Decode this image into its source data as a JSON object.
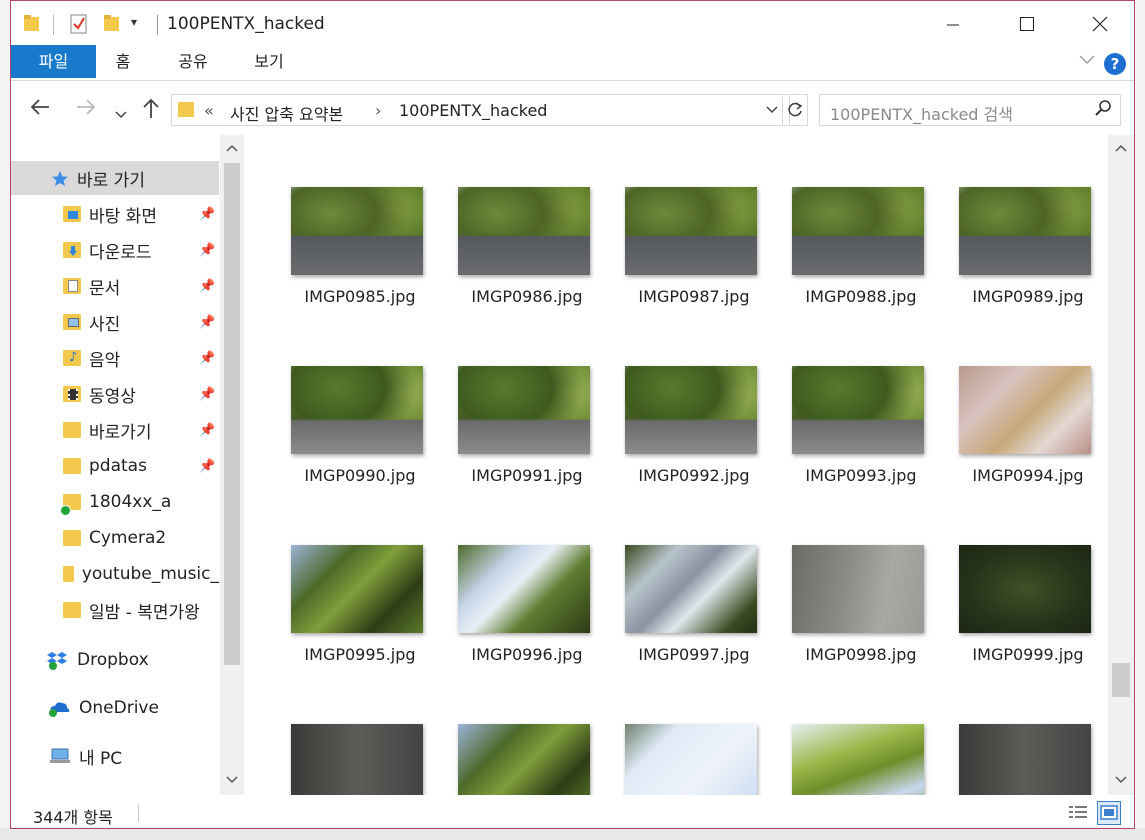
{
  "window": {
    "title": "100PENTX_hacked"
  },
  "ribbon": {
    "tabs": [
      {
        "label": "파일",
        "active": true
      },
      {
        "label": "홈",
        "active": false
      },
      {
        "label": "공유",
        "active": false
      },
      {
        "label": "보기",
        "active": false
      }
    ],
    "help_label": "?"
  },
  "address": {
    "prefix": "«",
    "crumbs": [
      "사진 압축 요약본",
      "100PENTX_hacked"
    ],
    "separator": "›"
  },
  "search": {
    "placeholder": "100PENTX_hacked 검색"
  },
  "nav": {
    "quick_access": "바로 가기",
    "pinned": [
      {
        "label": "바탕 화면",
        "icon": "desktop-folder-icon"
      },
      {
        "label": "다운로드",
        "icon": "downloads-folder-icon"
      },
      {
        "label": "문서",
        "icon": "documents-folder-icon"
      },
      {
        "label": "사진",
        "icon": "pictures-folder-icon"
      },
      {
        "label": "음악",
        "icon": "music-folder-icon"
      },
      {
        "label": "동영상",
        "icon": "videos-folder-icon"
      },
      {
        "label": "바로가기",
        "icon": "folder-icon"
      },
      {
        "label": "pdatas",
        "icon": "folder-icon"
      }
    ],
    "recent": [
      {
        "label": "1804xx_a",
        "synced": true
      },
      {
        "label": "Cymera2",
        "synced": false
      },
      {
        "label": "youtube_music_",
        "synced": false
      },
      {
        "label": "일밤 - 복면가왕",
        "synced": false
      }
    ],
    "dropbox": "Dropbox",
    "onedrive": "OneDrive",
    "this_pc": "내 PC"
  },
  "files": [
    {
      "name": "IMGP0985.jpg",
      "style": "img-street"
    },
    {
      "name": "IMGP0986.jpg",
      "style": "img-street"
    },
    {
      "name": "IMGP0987.jpg",
      "style": "img-street"
    },
    {
      "name": "IMGP0988.jpg",
      "style": "img-street"
    },
    {
      "name": "IMGP0989.jpg",
      "style": "img-street"
    },
    {
      "name": "IMGP0990.jpg",
      "style": "img-street2"
    },
    {
      "name": "IMGP0991.jpg",
      "style": "img-street2"
    },
    {
      "name": "IMGP0992.jpg",
      "style": "img-street2"
    },
    {
      "name": "IMGP0993.jpg",
      "style": "img-street2"
    },
    {
      "name": "IMGP0994.jpg",
      "style": "img-pink"
    },
    {
      "name": "IMGP0995.jpg",
      "style": "img-blur1"
    },
    {
      "name": "IMGP0996.jpg",
      "style": "img-blur2"
    },
    {
      "name": "IMGP0997.jpg",
      "style": "img-blur3"
    },
    {
      "name": "IMGP0998.jpg",
      "style": "img-grey"
    },
    {
      "name": "IMGP0999.jpg",
      "style": "img-dkgreen"
    },
    {
      "name": "",
      "style": "img-dark"
    },
    {
      "name": "",
      "style": "img-blur1"
    },
    {
      "name": "",
      "style": "img-sky"
    },
    {
      "name": "",
      "style": "img-leaf"
    },
    {
      "name": "",
      "style": "img-dark"
    }
  ],
  "status": {
    "item_count": "344개 항목"
  }
}
